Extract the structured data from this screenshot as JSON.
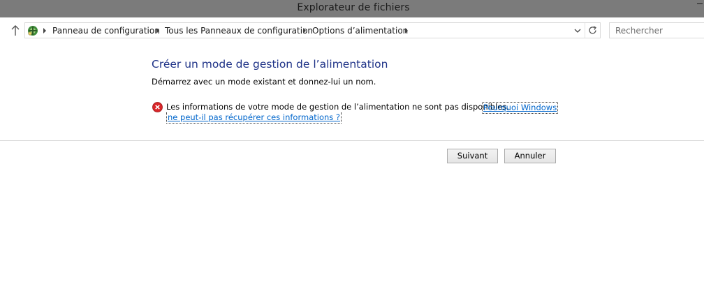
{
  "window": {
    "title": "Explorateur de fichiers"
  },
  "navigation": {
    "breadcrumbs": [
      {
        "label": "Panneau de configuration"
      },
      {
        "label": "Tous les Panneaux de configuration"
      },
      {
        "label": "Options d’alimentation"
      }
    ],
    "search_placeholder": "Rechercher",
    "icons": {
      "up": "up-arrow-icon",
      "location": "control-panel-icon",
      "dropdown": "chevron-down-icon",
      "refresh": "refresh-icon"
    }
  },
  "content": {
    "heading": "Créer un mode de gestion de l’alimentation",
    "subtext": "Démarrez avec un mode existant et donnez-lui un nom.",
    "error": {
      "icon": "error-icon",
      "message": "Les informations de votre mode de gestion de l’alimentation ne sont pas disponibles.",
      "link_line1": "Pourquoi Windows",
      "link_line2": "ne peut-il pas récupérer ces informations ?"
    }
  },
  "buttons": {
    "next_label": "Suivant",
    "cancel_label": "Annuler"
  },
  "colors": {
    "titlebar": "#7b7b7b",
    "heading": "#1e3287",
    "link": "#0066cc",
    "error_red": "#d9262a"
  }
}
